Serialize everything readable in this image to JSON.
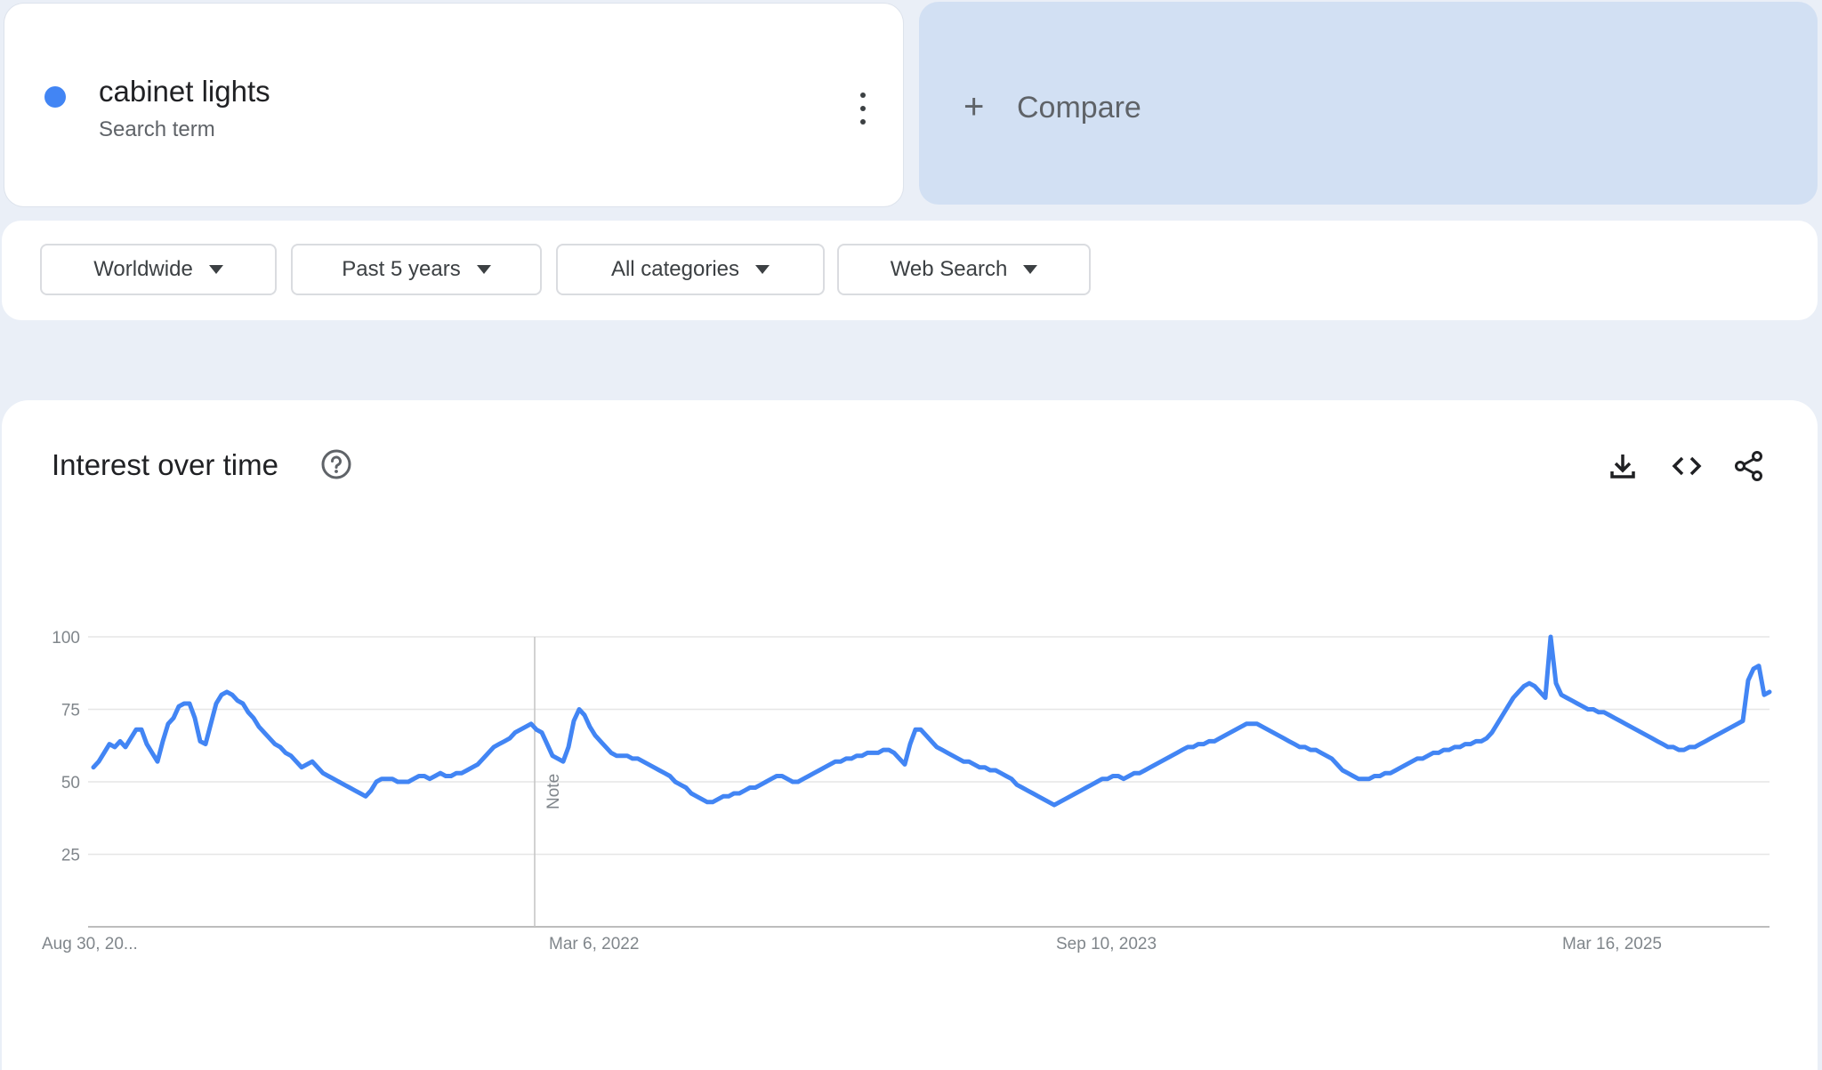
{
  "term": {
    "title": "cabinet lights",
    "subtitle": "Search term",
    "color": "#4285f4"
  },
  "compare": {
    "label": "Compare",
    "icon": "plus-icon"
  },
  "filters": [
    {
      "label": "Worldwide"
    },
    {
      "label": "Past 5 years"
    },
    {
      "label": "All categories"
    },
    {
      "label": "Web Search"
    }
  ],
  "panel": {
    "title": "Interest over time",
    "help_icon": "help-circle-icon",
    "actions": [
      "download-icon",
      "embed-code-icon",
      "share-icon"
    ]
  },
  "chart_data": {
    "type": "line",
    "title": "",
    "xlabel": "",
    "ylabel": "",
    "ylim": [
      0,
      100
    ],
    "yticks": [
      25,
      50,
      75,
      100
    ],
    "x_tick_labels": [
      "Aug 30, 20...",
      "Mar 6, 2022",
      "Sep 10, 2023",
      "Mar 16, 2025"
    ],
    "note_label": "Note",
    "grid": true,
    "line_color": "#4285f4",
    "series": [
      {
        "name": "",
        "values": [
          55,
          57,
          60,
          63,
          62,
          64,
          62,
          65,
          68,
          68,
          63,
          60,
          57,
          64,
          70,
          72,
          76,
          77,
          77,
          72,
          64,
          63,
          70,
          77,
          80,
          81,
          80,
          78,
          77,
          74,
          72,
          69,
          67,
          65,
          63,
          62,
          60,
          59,
          57,
          55,
          56,
          57,
          55,
          53,
          52,
          51,
          50,
          49,
          48,
          47,
          46,
          45,
          47,
          50,
          51,
          51,
          51,
          50,
          50,
          50,
          51,
          52,
          52,
          51,
          52,
          53,
          52,
          52,
          53,
          53,
          54,
          55,
          56,
          58,
          60,
          62,
          63,
          64,
          65,
          67,
          68,
          69,
          70,
          68,
          67,
          63,
          59,
          58,
          57,
          62,
          71,
          75,
          73,
          69,
          66,
          64,
          62,
          60,
          59,
          59,
          59,
          58,
          58,
          57,
          56,
          55,
          54,
          53,
          52,
          50,
          49,
          48,
          46,
          45,
          44,
          43,
          43,
          44,
          45,
          45,
          46,
          46,
          47,
          48,
          48,
          49,
          50,
          51,
          52,
          52,
          51,
          50,
          50,
          51,
          52,
          53,
          54,
          55,
          56,
          57,
          57,
          58,
          58,
          59,
          59,
          60,
          60,
          60,
          61,
          61,
          60,
          58,
          56,
          63,
          68,
          68,
          66,
          64,
          62,
          61,
          60,
          59,
          58,
          57,
          57,
          56,
          55,
          55,
          54,
          54,
          53,
          52,
          51,
          49,
          48,
          47,
          46,
          45,
          44,
          43,
          42,
          43,
          44,
          45,
          46,
          47,
          48,
          49,
          50,
          51,
          51,
          52,
          52,
          51,
          52,
          53,
          53,
          54,
          55,
          56,
          57,
          58,
          59,
          60,
          61,
          62,
          62,
          63,
          63,
          64,
          64,
          65,
          66,
          67,
          68,
          69,
          70,
          70,
          70,
          69,
          68,
          67,
          66,
          65,
          64,
          63,
          62,
          62,
          61,
          61,
          60,
          59,
          58,
          56,
          54,
          53,
          52,
          51,
          51,
          51,
          52,
          52,
          53,
          53,
          54,
          55,
          56,
          57,
          58,
          58,
          59,
          60,
          60,
          61,
          61,
          62,
          62,
          63,
          63,
          64,
          64,
          65,
          67,
          70,
          73,
          76,
          79,
          81,
          83,
          84,
          83,
          81,
          79,
          100,
          84,
          80,
          79,
          78,
          77,
          76,
          75,
          75,
          74,
          74,
          73,
          72,
          71,
          70,
          69,
          68,
          67,
          66,
          65,
          64,
          63,
          62,
          62,
          61,
          61,
          62,
          62,
          63,
          64,
          65,
          66,
          67,
          68,
          69,
          70,
          71,
          85,
          89,
          90,
          80,
          81
        ]
      }
    ]
  }
}
